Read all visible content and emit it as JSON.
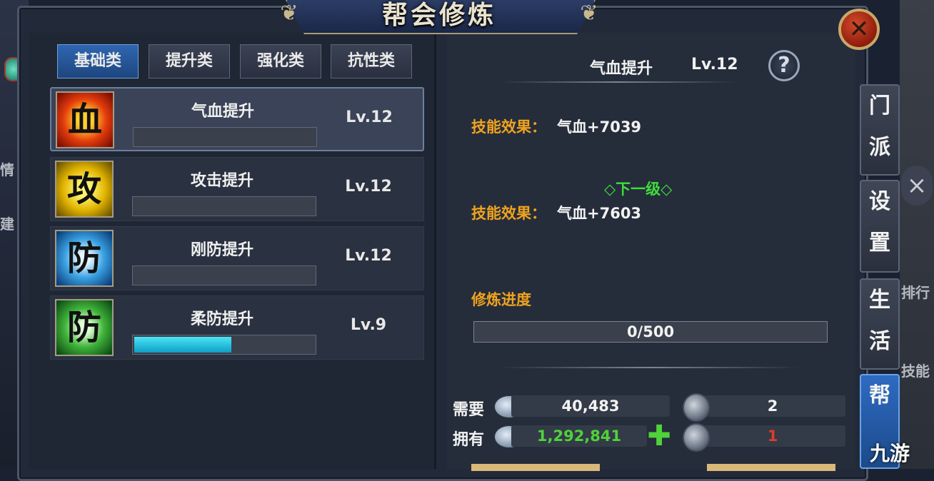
{
  "window": {
    "title": "帮会修炼",
    "close_icon": "close-icon"
  },
  "tabs": [
    {
      "label": "基础类",
      "active": true
    },
    {
      "label": "提升类",
      "active": false
    },
    {
      "label": "强化类",
      "active": false
    },
    {
      "label": "抗性类",
      "active": false
    }
  ],
  "skills": [
    {
      "icon_char": "血",
      "icon": "blood-icon",
      "name": "气血提升",
      "level": "Lv.12",
      "progress": 0,
      "selected": true
    },
    {
      "icon_char": "攻",
      "icon": "attack-icon",
      "name": "攻击提升",
      "level": "Lv.12",
      "progress": 0,
      "selected": false
    },
    {
      "icon_char": "防",
      "icon": "defense-icon",
      "name": "刚防提升",
      "level": "Lv.12",
      "progress": 0,
      "selected": false
    },
    {
      "icon_char": "防",
      "icon": "soft-defense-icon",
      "name": "柔防提升",
      "level": "Lv.9",
      "progress": 0.54,
      "selected": false
    }
  ],
  "detail": {
    "name": "气血提升",
    "level": "Lv.12",
    "help_char": "?",
    "current_effect_label": "技能效果：",
    "current_effect_value": "气血+7039",
    "next_level_label": "◇下一级◇",
    "next_effect_label": "技能效果：",
    "next_effect_value": "气血+7603",
    "progress_label": "修炼进度",
    "progress_text": "0/500"
  },
  "cost": {
    "need_label": "需要",
    "need_silver": "40,483",
    "need_token": "2",
    "have_label": "拥有",
    "have_silver": "1,292,841",
    "have_token": "1",
    "plus_char": "✚"
  },
  "side_tabs": [
    {
      "chars": [
        "门",
        "派"
      ],
      "active": false
    },
    {
      "chars": [
        "设",
        "置"
      ],
      "active": false
    },
    {
      "chars": [
        "生",
        "活"
      ],
      "active": false
    },
    {
      "chars": [
        "帮"
      ],
      "active": true
    }
  ],
  "background_text": {
    "rank": "排行",
    "skill": "技能",
    "left1": "情",
    "left2": "建"
  },
  "watermark": "九游",
  "colors": {
    "effect_label": "#f0a31e",
    "next_level": "#3fdd3c",
    "have_silver": "#4fd23a",
    "have_token": "#e23a2a",
    "active_tab": "#2f66b0"
  }
}
